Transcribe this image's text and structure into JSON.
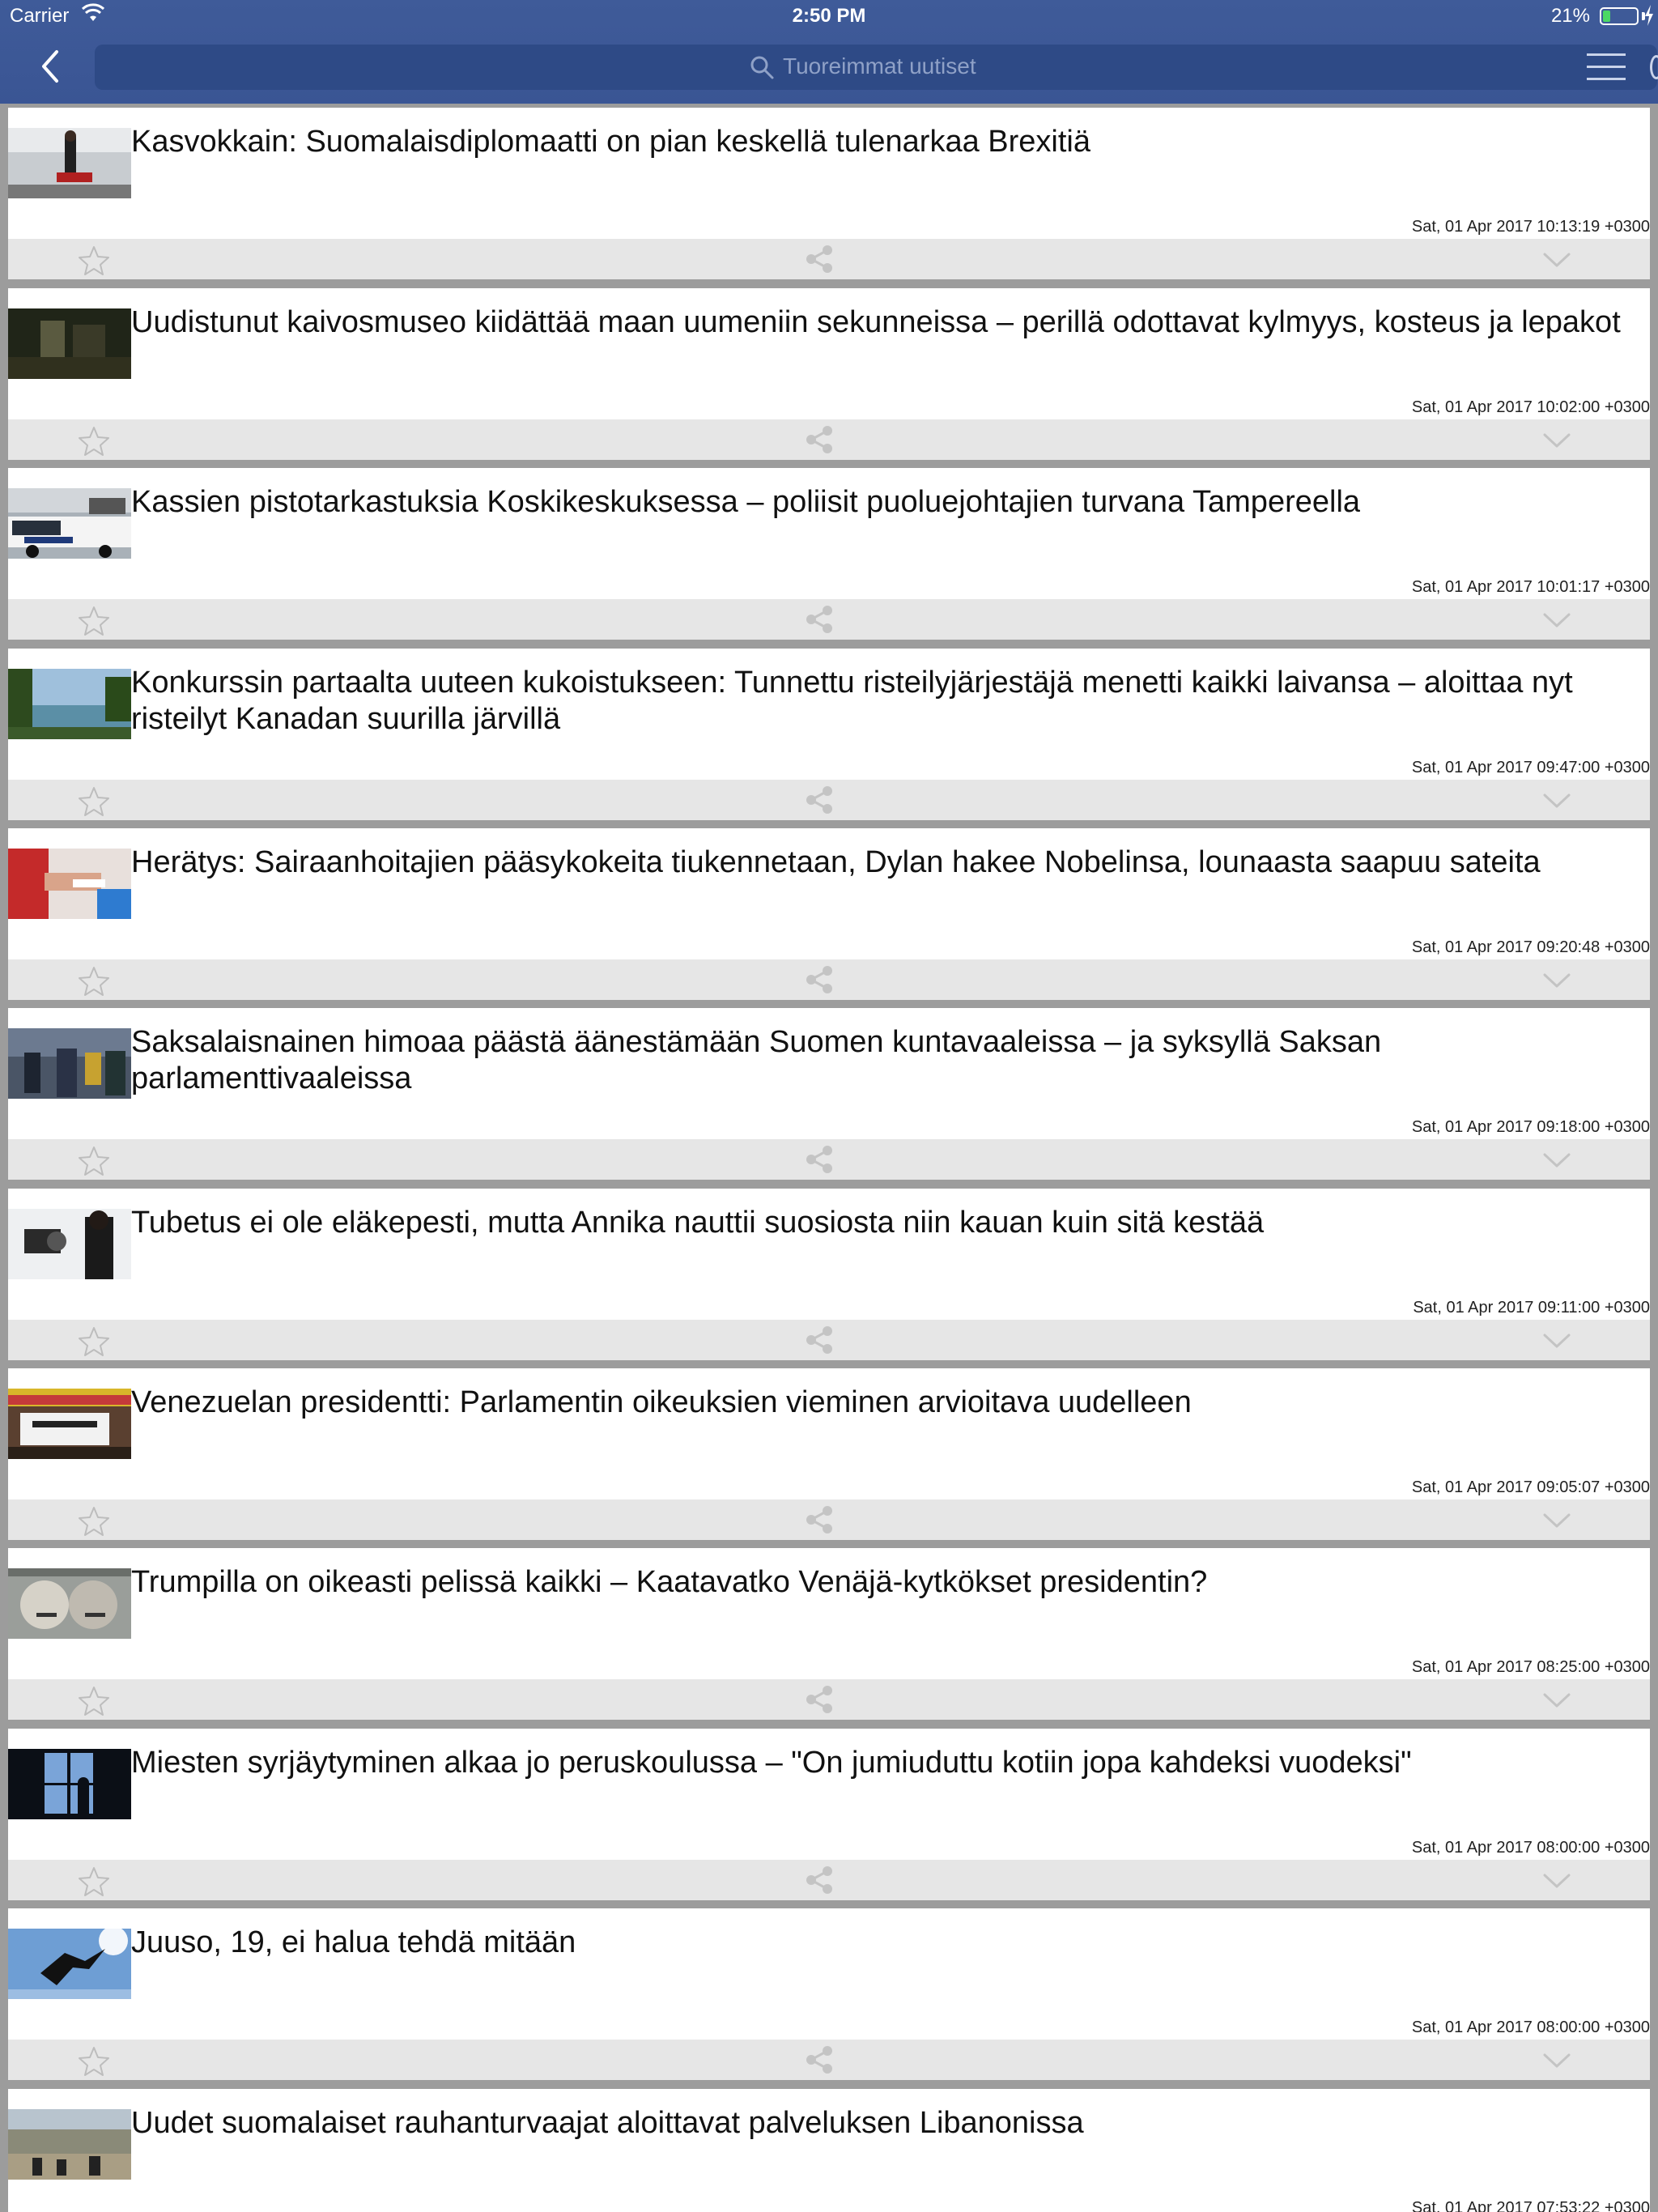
{
  "status_bar": {
    "carrier": "Carrier",
    "time": "2:50 PM",
    "battery": "21%"
  },
  "search": {
    "placeholder": "Tuoreimmat uutiset"
  },
  "colors": {
    "nav_bar": "#3a5594",
    "search_field": "#2e4a86",
    "action_bar": "#e6e6e6",
    "separator": "#9c9c9c",
    "battery_fill": "#4cd964"
  },
  "icons": {
    "back": "chevron-left-icon",
    "search": "search-icon",
    "menu": "hamburger-menu-icon",
    "favorite": "star-outline-icon",
    "share": "share-icon",
    "expand": "chevron-down-icon"
  },
  "articles": [
    {
      "title": "Kasvokkain: Suomalaisdiplomaatti on pian keskellä tulenarkaa Brexitiä",
      "date": "Sat, 01 Apr 2017 10:13:19 +0300",
      "thumb": "diplomat-portrait"
    },
    {
      "title": "Uudistunut kaivosmuseo kiidättää maan uumeniin sekunneissa – perillä odottavat kylmyys, kosteus ja lepakot",
      "date": "Sat, 01 Apr 2017 10:02:00 +0300",
      "thumb": "mine-tunnel"
    },
    {
      "title": "Kassien pistotarkastuksia Koskikeskuksessa – poliisit puoluejohtajien turvana Tampereella",
      "date": "Sat, 01 Apr 2017 10:01:17 +0300",
      "thumb": "police-car"
    },
    {
      "title": "Konkurssin partaalta uuteen kukoistukseen: Tunnettu risteilyjärjestäjä menetti kaikki laivansa – aloittaa nyt risteilyt Kanadan suurilla järvillä",
      "date": "Sat, 01 Apr 2017 09:47:00 +0300",
      "thumb": "lake-shore"
    },
    {
      "title": "Herätys: Sairaanhoitajien pääsykokeita tiukennetaan, Dylan hakee Nobelinsa, lounaasta saapuu sateita",
      "date": "Sat, 01 Apr 2017 09:20:48 +0300",
      "thumb": "hospital-hands"
    },
    {
      "title": "Saksalaisnainen himoaa päästä äänestämään Suomen kuntavaaleissa – ja syksyllä Saksan parlamenttivaaleissa",
      "date": "Sat, 01 Apr 2017 09:18:00 +0300",
      "thumb": "street-crowd"
    },
    {
      "title": "Tubetus ei ole eläkepesti, mutta Annika nauttii suosiosta niin kauan kuin sitä kestää",
      "date": "Sat, 01 Apr 2017 09:11:00 +0300",
      "thumb": "youtuber-camera"
    },
    {
      "title": "Venezuelan presidentti: Parlamentin oikeuksien vieminen arvioitava uudelleen",
      "date": "Sat, 01 Apr 2017 09:05:07 +0300",
      "thumb": "protest-banner"
    },
    {
      "title": "Trumpilla on oikeasti pelissä kaikki – Kaatavatko Venäjä-kytkökset presidentin?",
      "date": "Sat, 01 Apr 2017 08:25:00 +0300",
      "thumb": "mural-faces"
    },
    {
      "title": "Miesten syrjäytyminen alkaa jo peruskoulussa – \"On jumiuduttu kotiin jopa kahdeksi vuodeksi\"",
      "date": "Sat, 01 Apr 2017 08:00:00 +0300",
      "thumb": "window-silhouette"
    },
    {
      "title": "Juuso, 19, ei halua tehdä mitään",
      "date": "Sat, 01 Apr 2017 08:00:00 +0300",
      "thumb": "skater-sky"
    },
    {
      "title": "Uudet suomalaiset rauhanturvaajat aloittavat palveluksen Libanonissa",
      "date": "Sat, 01 Apr 2017 07:53:22 +0300",
      "thumb": "un-hillside"
    }
  ]
}
